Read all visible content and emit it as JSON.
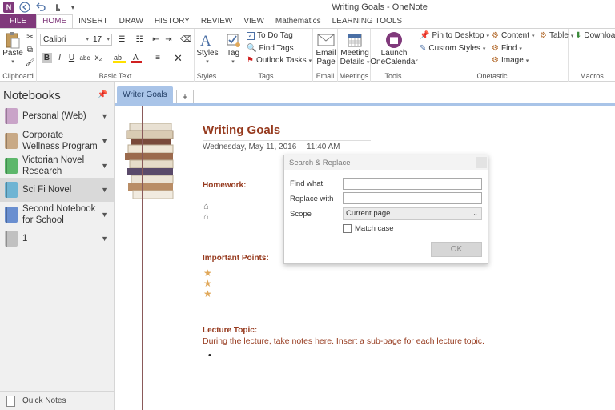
{
  "window": {
    "title": "Writing Goals - OneNote",
    "app_logo": "N"
  },
  "qat": {
    "back_icon": "back-arrow-icon",
    "undo_icon": "undo-icon",
    "touch_icon": "touch-mode-icon",
    "customize_icon": "customize-qat-icon"
  },
  "tabs": [
    "FILE",
    "HOME",
    "INSERT",
    "DRAW",
    "HISTORY",
    "REVIEW",
    "VIEW",
    "Mathematics",
    "LEARNING TOOLS"
  ],
  "ribbon": {
    "clipboard": {
      "paste": "Paste",
      "label": "Clipboard"
    },
    "basic_text": {
      "font": "Calibri",
      "size": "17",
      "label": "Basic Text",
      "bold": "B",
      "italic": "I",
      "underline": "U",
      "strike": "abc",
      "subscript": "x₂"
    },
    "styles": {
      "button": "Styles",
      "label": "Styles"
    },
    "tags": {
      "tag": "Tag",
      "todo": "To Do Tag",
      "find": "Find Tags",
      "outlook": "Outlook Tasks",
      "label": "Tags"
    },
    "email": {
      "button_line1": "Email",
      "button_line2": "Page",
      "label": "Email"
    },
    "meetings": {
      "button_line1": "Meeting",
      "button_line2": "Details",
      "label": "Meetings"
    },
    "tools": {
      "button_line1": "Launch",
      "button_line2": "OneCalendar",
      "label": "Tools"
    },
    "onetastic": {
      "pin": "Pin to Desktop",
      "custom": "Custom Styles",
      "content": "Content",
      "find": "Find",
      "image": "Image",
      "table": "Table",
      "label": "Onetastic"
    },
    "macros": {
      "download": "Downloa",
      "label": "Macros"
    }
  },
  "notebooks": {
    "header": "Notebooks",
    "items": [
      {
        "label": "Personal (Web)",
        "color": "#c9a4c8"
      },
      {
        "label": "Corporate Wellness Program",
        "color": "#c8a986"
      },
      {
        "label": "Victorian Novel Research",
        "color": "#5db76b"
      },
      {
        "label": "Sci Fi Novel",
        "color": "#6fb4d3"
      },
      {
        "label": "Second Notebook for School",
        "color": "#6a8fd0"
      },
      {
        "label": "1",
        "color": "#c1c1c1"
      }
    ],
    "quick_notes": "Quick Notes"
  },
  "section_tabs": {
    "active": "Writer Goals",
    "add": "+"
  },
  "page": {
    "title": "Writing Goals",
    "date": "Wednesday, May 11, 2016",
    "time": "11:40 AM",
    "homework": "Homework:",
    "important": "Important Points:",
    "lecture_heading": "Lecture Topic:",
    "lecture_text": "During the lecture, take notes here.  Insert a sub-page for each lecture topic.",
    "bullet": "•"
  },
  "dialog": {
    "title": "Search & Replace",
    "find_label": "Find what",
    "find_value": "",
    "replace_label": "Replace with",
    "replace_value": "",
    "scope_label": "Scope",
    "scope_value": "Current page",
    "match_case": "Match case",
    "ok": "OK"
  }
}
